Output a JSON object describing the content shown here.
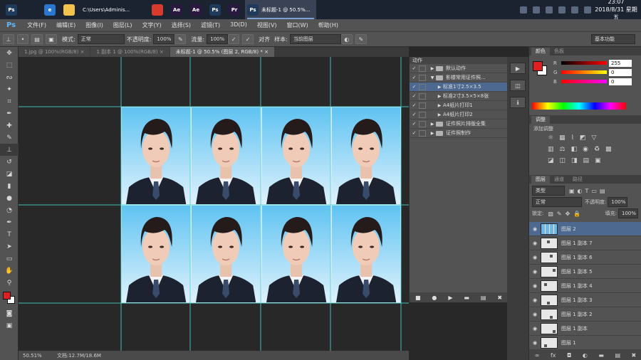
{
  "taskbar": {
    "explorer_title": "C:\\Users\\Adminis...",
    "ps_window_title": "未标题-1 @ 50.5%...",
    "clock_time": "23:07",
    "clock_date": "2018/8/31 星期五",
    "apps": [
      {
        "name": "photoshop-app-icon",
        "label": "Ps",
        "color": "#1f3b5c"
      },
      {
        "name": "search-icon",
        "label": "",
        "color": "#1b2230"
      },
      {
        "name": "ie-icon",
        "label": "e",
        "color": "#2b77cf"
      },
      {
        "name": "folder-icon",
        "label": "",
        "color": "#f2c14e"
      },
      {
        "name": "chrome-icon",
        "label": "",
        "color": "#d93a2e"
      },
      {
        "name": "ae-icon",
        "label": "Ae",
        "color": "#2a1840"
      },
      {
        "name": "ae2-icon",
        "label": "Ae",
        "color": "#2a1840"
      },
      {
        "name": "ps2-icon",
        "label": "Ps",
        "color": "#1f3b5c"
      },
      {
        "name": "pr-icon",
        "label": "Pr",
        "color": "#2a1840"
      }
    ]
  },
  "menubar": {
    "logo": "Ps",
    "items": [
      "文件(F)",
      "编辑(E)",
      "图像(I)",
      "图层(L)",
      "文字(Y)",
      "选择(S)",
      "滤镜(T)",
      "3D(D)",
      "视图(V)",
      "窗口(W)",
      "帮助(H)"
    ]
  },
  "options": {
    "mode_label": "模式:",
    "mode_value": "正常",
    "opacity_label": "不透明度:",
    "opacity_value": "100%",
    "flow_label": "流量:",
    "flow_value": "100%",
    "align_label": "对齐",
    "sample_label": "样本:",
    "sample_value": "当前图层",
    "workspace_value": "基本功能"
  },
  "tabs": [
    {
      "label": "1.jpg @ 100%(RGB/8)",
      "active": false
    },
    {
      "label": "1 副本 1 @ 100%(RGB/8)",
      "active": false
    },
    {
      "label": "未标题-1 @ 50.5% (图层 2, RGB/8) *",
      "active": true
    }
  ],
  "statusbar": {
    "zoom": "50.51%",
    "doc": "文档:12.7M/18.6M"
  },
  "actions_panel": {
    "title": "动作",
    "rows": [
      {
        "label": "默认动作",
        "indent": 0,
        "type": "folder",
        "open": false,
        "selected": false
      },
      {
        "label": "影楼常用证件照...",
        "indent": 0,
        "type": "folder",
        "open": true,
        "selected": false
      },
      {
        "label": "标准1寸2.5×3.5",
        "indent": 1,
        "type": "action",
        "open": false,
        "selected": true
      },
      {
        "label": "标准2寸3.5×5×8张",
        "indent": 1,
        "type": "action",
        "open": false,
        "selected": false
      },
      {
        "label": "A4纸片打印1",
        "indent": 1,
        "type": "action",
        "open": false,
        "selected": false
      },
      {
        "label": "A4纸片打印2",
        "indent": 1,
        "type": "action",
        "open": false,
        "selected": false
      },
      {
        "label": "证件照片排版全集",
        "indent": 0,
        "type": "folder",
        "open": false,
        "selected": false
      },
      {
        "label": "证件照制作",
        "indent": 0,
        "type": "folder",
        "open": false,
        "selected": false
      }
    ]
  },
  "color_panel": {
    "tabs": [
      "颜色",
      "色板"
    ],
    "channels": [
      {
        "ch": "R",
        "value": "255"
      },
      {
        "ch": "G",
        "value": "0"
      },
      {
        "ch": "B",
        "value": "0"
      }
    ],
    "fg_color": "#e02020"
  },
  "adjust_panel": {
    "title": "调整",
    "subtitle": "添加调整"
  },
  "layers_panel": {
    "tabs": [
      "图层",
      "通道",
      "路径"
    ],
    "filter_label": "类型",
    "blend_value": "正常",
    "opacity_label": "不透明度:",
    "opacity_value": "100%",
    "lock_label": "锁定:",
    "fill_label": "填充:",
    "fill_value": "100%",
    "layers": [
      {
        "name": "图层 2",
        "selected": true
      },
      {
        "name": "图层 1 副本 7",
        "selected": false
      },
      {
        "name": "图层 1 副本 6",
        "selected": false
      },
      {
        "name": "图层 1 副本 5",
        "selected": false
      },
      {
        "name": "图层 1 副本 4",
        "selected": false
      },
      {
        "name": "图层 1 副本 3",
        "selected": false
      },
      {
        "name": "图层 1 副本 2",
        "selected": false
      },
      {
        "name": "图层 1 副本",
        "selected": false
      },
      {
        "name": "图层 1",
        "selected": false
      }
    ]
  },
  "photos": {
    "rows": 2,
    "cols": 4
  }
}
